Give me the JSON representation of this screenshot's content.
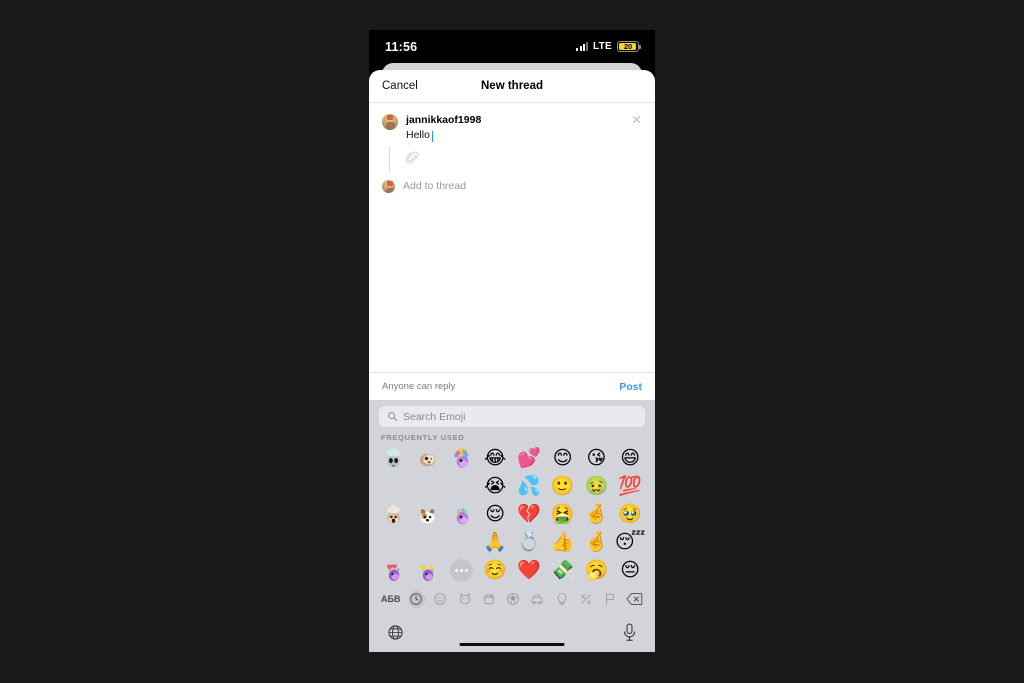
{
  "status_bar": {
    "time": "11:56",
    "network": "LTE",
    "battery_level": "20",
    "battery_color": "#f5cf2a",
    "signal_icon": "cellular-signal-icon"
  },
  "nav": {
    "cancel_label": "Cancel",
    "title": "New thread"
  },
  "compose": {
    "username": "jannikkaof1998",
    "text": "Hello",
    "close_icon": "close-icon",
    "attach_icon": "paperclip-icon",
    "add_to_thread_placeholder": "Add to thread"
  },
  "footer": {
    "reply_setting": "Anyone can reply",
    "post_label": "Post",
    "post_color": "#3b9cf0"
  },
  "keyboard": {
    "search_placeholder": "Search Emoji",
    "search_icon": "search-icon",
    "section_label": "FREQUENTLY USED",
    "emoji_rows": [
      [
        "memoji-alien",
        "memoji-sloth",
        "memoji-unicorn-rainbow",
        "😂",
        "💕",
        "😊",
        "😘",
        "😄"
      ],
      [
        "",
        "",
        "",
        "😭",
        "💦",
        "🙂",
        "🤢",
        "💯"
      ],
      [
        "memoji-monkey",
        "memoji-dog",
        "memoji-unicorn-horns",
        "😌",
        "💔",
        "🤮",
        "🤞",
        "🥹"
      ],
      [
        "",
        "",
        "",
        "🙏",
        "💍",
        "👍",
        "🤞",
        "😴"
      ],
      [
        "memoji-unicorn-hearts",
        "memoji-unicorn-stars",
        "more-dots",
        "☺️",
        "❤️",
        "💸",
        "🥱",
        "😔"
      ]
    ],
    "categories": [
      {
        "name": "abc-cyrillic",
        "label": "АБВ",
        "selected": false
      },
      {
        "name": "recents-clock-icon",
        "label": "",
        "selected": true
      },
      {
        "name": "smileys-icon",
        "label": "",
        "selected": false
      },
      {
        "name": "animals-icon",
        "label": "",
        "selected": false
      },
      {
        "name": "food-icon",
        "label": "",
        "selected": false
      },
      {
        "name": "activity-icon",
        "label": "",
        "selected": false
      },
      {
        "name": "travel-icon",
        "label": "",
        "selected": false
      },
      {
        "name": "objects-bulb-icon",
        "label": "",
        "selected": false
      },
      {
        "name": "symbols-icon",
        "label": "",
        "selected": false
      },
      {
        "name": "flags-icon",
        "label": "",
        "selected": false
      },
      {
        "name": "backspace-icon",
        "label": "",
        "selected": false
      }
    ],
    "bottom": {
      "globe_icon": "globe-icon",
      "mic_icon": "microphone-icon"
    }
  }
}
